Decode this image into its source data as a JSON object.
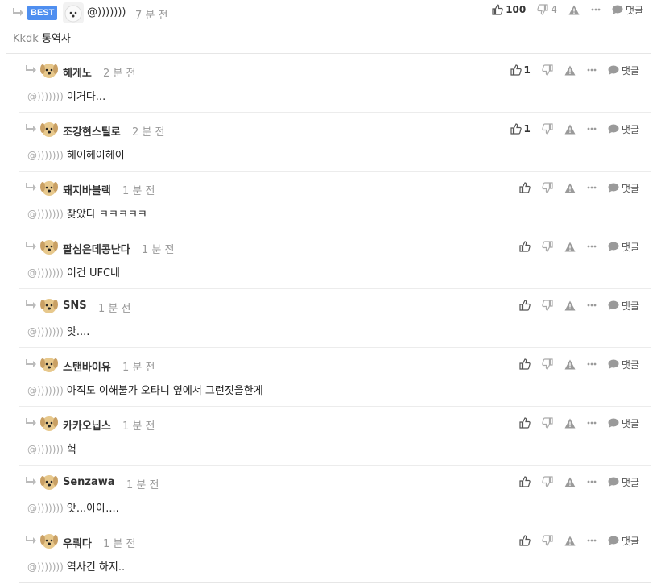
{
  "best_comment": {
    "badge": "BEST",
    "nickname": "@)))))))",
    "time": "7 분 전",
    "text_prefix": "Kkdk",
    "text": "통역사",
    "likes": "100",
    "dislikes": "4",
    "reply_label": "댓글"
  },
  "replies": [
    {
      "nickname": "헤게노",
      "time": "2 분 전",
      "mention": "@)))))))",
      "text": "이거다...",
      "likes": "1",
      "reply_label": "댓글"
    },
    {
      "nickname": "조강현스틸로",
      "time": "2 분 전",
      "mention": "@)))))))",
      "text": "헤이헤이헤이",
      "likes": "1",
      "reply_label": "댓글"
    },
    {
      "nickname": "돼지바블랙",
      "time": "1 분 전",
      "mention": "@)))))))",
      "text": "찾았다 ㅋㅋㅋㅋㅋ",
      "likes": "",
      "reply_label": "댓글"
    },
    {
      "nickname": "팥심은데콩난다",
      "time": "1 분 전",
      "mention": "@)))))))",
      "text": "이건 UFC네",
      "likes": "",
      "reply_label": "댓글"
    },
    {
      "nickname": "SNS",
      "time": "1 분 전",
      "mention": "@)))))))",
      "text": "앗....",
      "likes": "",
      "reply_label": "댓글"
    },
    {
      "nickname": "스탠바이유",
      "time": "1 분 전",
      "mention": "@)))))))",
      "text": "아직도 이해불가 오타니 옆에서 그런짓을한게",
      "likes": "",
      "reply_label": "댓글"
    },
    {
      "nickname": "카카오닙스",
      "time": "1 분 전",
      "mention": "@)))))))",
      "text": "헉",
      "likes": "",
      "reply_label": "댓글"
    },
    {
      "nickname": "Senzawa",
      "time": "1 분 전",
      "mention": "@)))))))",
      "text": "앗...아아....",
      "likes": "",
      "reply_label": "댓글"
    },
    {
      "nickname": "우뤄다",
      "time": "1 분 전",
      "mention": "@)))))))",
      "text": "역사긴 하지..",
      "likes": "",
      "reply_label": "댓글"
    }
  ],
  "colors": {
    "badge": "#4f8ff0",
    "icon": "#9a9a9a",
    "mention": "#aaaaaa",
    "divider": "#ececec"
  }
}
